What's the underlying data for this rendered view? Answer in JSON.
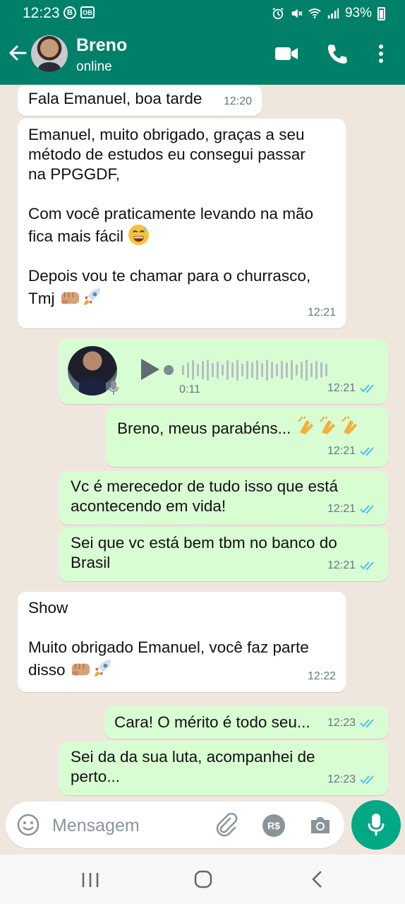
{
  "status_bar": {
    "time": "12:23",
    "battery": "93%",
    "badge_b": "B",
    "badge_box": "OB"
  },
  "header": {
    "contact_name": "Breno",
    "contact_status": "online"
  },
  "messages": [
    {
      "dir": "in",
      "text": "Fala Emanuel, boa tarde",
      "time": "12:20"
    },
    {
      "dir": "in",
      "text": "Emanuel, muito obrigado, graças a seu\nmétodo de estudos eu consegui passar\nna PPGGDF,\n\nCom você praticamente levando na mão\nfica mais fácil",
      "text2": "Depois vou te chamar para o churrasco,\nTmj",
      "time": "12:21"
    },
    {
      "dir": "out",
      "type": "voice",
      "duration": "0:11",
      "time": "12:21"
    },
    {
      "dir": "out",
      "text": "Breno, meus parabéns...",
      "time": "12:21"
    },
    {
      "dir": "out",
      "text": "Vc é merecedor de tudo isso que está\nacontecendo em vida!",
      "time": "12:21"
    },
    {
      "dir": "out",
      "text": "Sei que vc está bem tbm no banco do\nBrasil",
      "time": "12:21"
    },
    {
      "dir": "in",
      "text": "Show",
      "text2": "Muito obrigado Emanuel, você faz parte\ndisso",
      "time": "12:22"
    },
    {
      "dir": "out",
      "text": "Cara! O mérito é todo seu...",
      "time": "12:23"
    },
    {
      "dir": "out",
      "text": "Sei da da sua luta, acompanhei de\nperto...",
      "time": "12:23"
    }
  ],
  "composer": {
    "placeholder": "Mensagem",
    "pay_label": "R$"
  },
  "icons": {
    "back": "arrow-left-icon",
    "video": "video-call-icon",
    "call": "phone-icon",
    "menu": "more-vertical-icon",
    "emoji": "emoji-icon",
    "attach": "paperclip-icon",
    "pay": "payment-icon",
    "camera": "camera-icon",
    "mic": "microphone-icon"
  },
  "colors": {
    "header": "#008069",
    "outgoing": "#d9fdd3",
    "incoming": "#ffffff",
    "accent": "#00a884",
    "read_ticks": "#53bdeb"
  }
}
